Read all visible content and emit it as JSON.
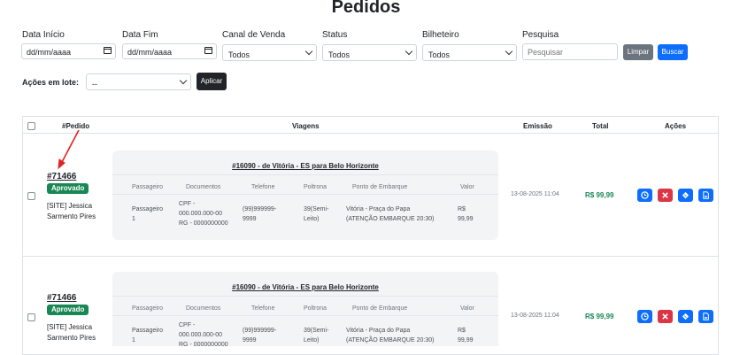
{
  "page": {
    "title": "Pedidos"
  },
  "filters": {
    "data_inicio": {
      "label": "Data Início",
      "value": "dd/mm/aaaa"
    },
    "data_fim": {
      "label": "Data Fim",
      "value": "dd/mm/aaaa"
    },
    "canal_venda": {
      "label": "Canal de Venda",
      "selected": "Todos"
    },
    "status": {
      "label": "Status",
      "selected": "Todos"
    },
    "bilheteiro": {
      "label": "Bilheteiro",
      "selected": "Todos"
    },
    "pesquisa": {
      "label": "Pesquisa",
      "placeholder": "Pesquisar"
    },
    "limpar_label": "Limpar",
    "buscar_label": "Buscar"
  },
  "batch": {
    "label": "Ações em lote:",
    "selected": "--",
    "apply_label": "Aplicar"
  },
  "table": {
    "headers": {
      "pedido": "#Pedido",
      "viagens": "Viagens",
      "emissao": "Emissão",
      "total": "Total",
      "acoes": "Ações"
    },
    "trip_headers": {
      "passageiro": "Passageiro",
      "documentos": "Documentos",
      "telefone": "Telefone",
      "poltrona": "Poltrona",
      "embarque": "Ponto de Embarque",
      "valor": "Valor"
    },
    "rows": [
      {
        "order_id": "#71466",
        "status": "Aprovado",
        "customer_line1": "[SITE] Jessica",
        "customer_line2": "Sarmento Pires",
        "trip_title": "#16090 - de Vitória - ES para Belo Horizonte",
        "passenger": {
          "l1": "Passageiro",
          "l2": "1",
          "doc1": "CPF -",
          "doc2": "000.000.000-00",
          "doc3": "RG - 0000000000",
          "tel1": "(99)999999-",
          "tel2": "9999",
          "seat1": "39(Semi-",
          "seat2": "Leito)",
          "board1": "Vitória - Praça do Papa",
          "board2": "(ATENÇÃO EMBARQUE 20:30)",
          "val1": "R$",
          "val2": "99,99"
        },
        "emissao": "13-08-2025 11:04",
        "total": "R$ 99,99"
      },
      {
        "order_id": "#71466",
        "status": "Aprovado",
        "customer_line1": "[SITE] Jessica",
        "customer_line2": "Sarmento Pires",
        "trip_title": "#16090 - de Vitória - ES para Belo Horizonte",
        "passenger": {
          "l1": "Passageiro",
          "l2": "1",
          "doc1": "CPF -",
          "doc2": "000.000.000-00",
          "doc3": "RG - 0000000000",
          "tel1": "(99)999999-",
          "tel2": "9999",
          "seat1": "39(Semi-",
          "seat2": "Leito)",
          "board1": "Vitória - Praça do Papa",
          "board2": "(ATENÇÃO EMBARQUE 20:30)",
          "val1": "R$",
          "val2": "99,99"
        },
        "emissao": "13-08-2025 11:04",
        "total": "R$ 99,99"
      }
    ]
  },
  "colors": {
    "primary": "#0d6efd",
    "action_blue": "#0d6efd",
    "action_red": "#dc3545",
    "success": "#198754",
    "secondary": "#6c757d",
    "dark": "#212529",
    "annotation_arrow": "#e02020"
  },
  "icons": {
    "view": "clock-icon",
    "cancel": "x-icon",
    "ticket": "ticket-icon",
    "pdf": "pdf-icon"
  }
}
